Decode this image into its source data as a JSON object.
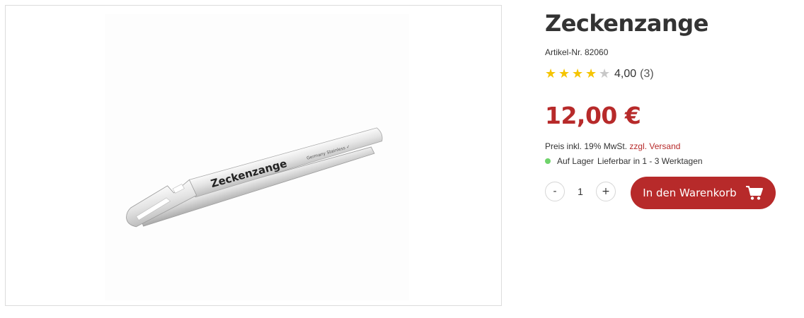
{
  "product": {
    "image_engraving": "Zeckenzange",
    "image_small_text": "Germany Stainless ✓",
    "title": "Zeckenzange",
    "article_number": "Artikel-Nr. 82060",
    "rating": {
      "stars_filled": 4,
      "stars_total": 5,
      "value": "4,00",
      "count": "(3)"
    },
    "price": "12,00 €",
    "tax_text": "Preis inkl. 19% MwSt.",
    "shipping_link": "zzgl. Versand",
    "stock_status": "Auf Lager",
    "delivery_text": "Lieferbar in 1 - 3 Werktagen",
    "quantity": {
      "decrease_label": "-",
      "value": "1",
      "increase_label": "+"
    },
    "add_to_cart_label": "In den Warenkorb",
    "cart_icon": "shopping-cart-icon"
  },
  "colors": {
    "accent": "#b72a2a",
    "star_filled": "#f5c400",
    "star_empty": "#c8c8c8",
    "stock_dot": "#6fd36b"
  }
}
